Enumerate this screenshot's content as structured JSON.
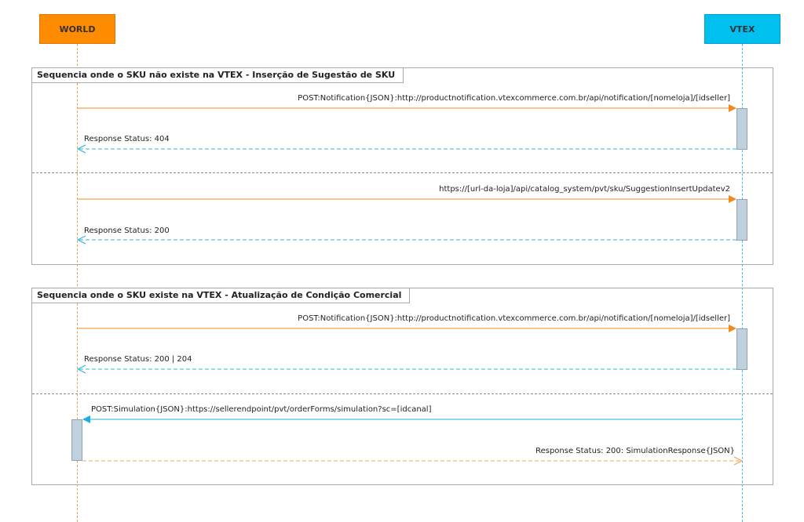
{
  "participants": {
    "world": {
      "label": "WORLD",
      "color": "#ff8c00",
      "border": "#d97500",
      "lifeline": "#f0a050"
    },
    "vtex": {
      "label": "VTEX",
      "color": "#00c0f0",
      "border": "#00a0d0",
      "lifeline": "#40c0e8"
    }
  },
  "frames": [
    {
      "title": "Sequencia onde o SKU não existe na VTEX - Inserção de Sugestão de SKU",
      "messages": [
        {
          "label": "POST:Notification{JSON}:http://productnotification.vtexcommerce.com.br/api/notification/[nomeloja]/[idseller]",
          "direction": "world-to-vtex",
          "style": "solid"
        },
        {
          "label": "Response Status: 404",
          "direction": "vtex-to-world",
          "style": "dashed"
        },
        {
          "label": "https://[url-da-loja]/api/catalog_system/pvt/sku/SuggestionInsertUpdatev2",
          "direction": "world-to-vtex",
          "style": "solid"
        },
        {
          "label": "Response Status: 200",
          "direction": "vtex-to-world",
          "style": "dashed"
        }
      ]
    },
    {
      "title": "Sequencia onde o SKU existe na VTEX - Atualização de Condição Comercial",
      "messages": [
        {
          "label": "POST:Notification{JSON}:http://productnotification.vtexcommerce.com.br/api/notification/[nomeloja]/[idseller]",
          "direction": "world-to-vtex",
          "style": "solid"
        },
        {
          "label": "Response Status: 200 | 204",
          "direction": "vtex-to-world",
          "style": "dashed"
        },
        {
          "label": "POST:Simulation{JSON}:https://sellerendpoint/pvt/orderForms/simulation?sc=[idcanal]",
          "direction": "vtex-to-world",
          "style": "solid"
        },
        {
          "label": "Response Status: 200: SimulationResponse{JSON}",
          "direction": "world-to-vtex",
          "style": "dashed"
        }
      ]
    }
  ],
  "colors": {
    "orange_arrow": "#f5a04a",
    "blue_arrow": "#2ab4e0",
    "orange_solid": "#f08a1c",
    "blue_solid": "#18b0e0"
  }
}
